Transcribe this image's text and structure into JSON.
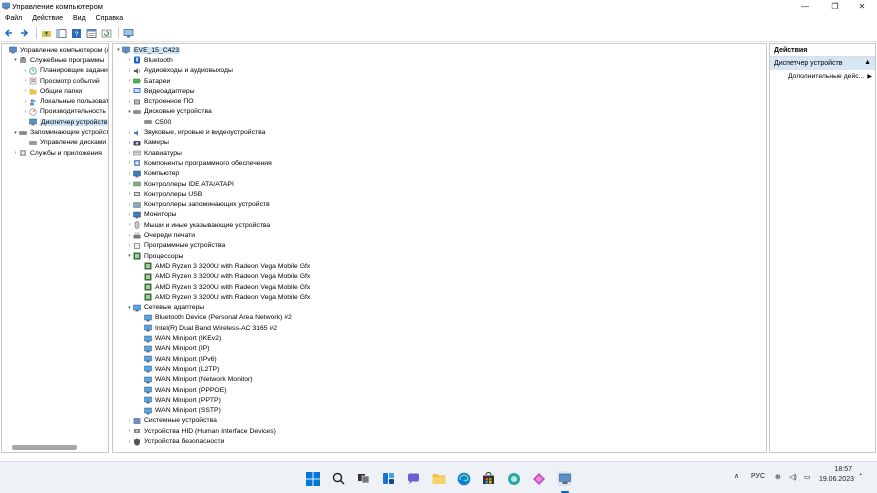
{
  "window": {
    "title": "Управление компьютером",
    "minimize": "—",
    "maximize": "❐",
    "close": "✕"
  },
  "menu": [
    "Файл",
    "Действие",
    "Вид",
    "Справка"
  ],
  "left_tree": [
    {
      "label": "Управление компьютером (лс",
      "level": 0,
      "arrow": "",
      "icon": "computer-management-icon"
    },
    {
      "label": "Служебные программы",
      "level": 1,
      "arrow": "▾",
      "icon": "tools-icon"
    },
    {
      "label": "Планировщик заданий",
      "level": 2,
      "arrow": "›",
      "icon": "clock-icon"
    },
    {
      "label": "Просмотр событий",
      "level": 2,
      "arrow": "›",
      "icon": "event-viewer-icon"
    },
    {
      "label": "Общие папки",
      "level": 2,
      "arrow": "›",
      "icon": "shared-folder-icon"
    },
    {
      "label": "Локальные пользовате",
      "level": 2,
      "arrow": "›",
      "icon": "users-icon"
    },
    {
      "label": "Производительность",
      "level": 2,
      "arrow": "›",
      "icon": "performance-icon"
    },
    {
      "label": "Диспетчер устройств",
      "level": 2,
      "arrow": "",
      "icon": "device-manager-icon",
      "selected": true
    },
    {
      "label": "Запоминающие устройств",
      "level": 1,
      "arrow": "▾",
      "icon": "storage-icon"
    },
    {
      "label": "Управление дисками",
      "level": 2,
      "arrow": "",
      "icon": "disk-icon"
    },
    {
      "label": "Службы и приложения",
      "level": 1,
      "arrow": "›",
      "icon": "services-icon"
    }
  ],
  "device_tree": [
    {
      "label": "EVE_15_C423",
      "level": 0,
      "arrow": "▾",
      "icon": "computer-icon",
      "selected": true
    },
    {
      "label": "Bluetooth",
      "level": 1,
      "arrow": "›",
      "icon": "bluetooth-icon"
    },
    {
      "label": "Аудиовходы и аудиовыходы",
      "level": 1,
      "arrow": "›",
      "icon": "audio-icon"
    },
    {
      "label": "Батареи",
      "level": 1,
      "arrow": "›",
      "icon": "battery-icon"
    },
    {
      "label": "Видеоадаптеры",
      "level": 1,
      "arrow": "›",
      "icon": "display-adapter-icon"
    },
    {
      "label": "Встроенное ПО",
      "level": 1,
      "arrow": "›",
      "icon": "firmware-icon"
    },
    {
      "label": "Дисковые устройства",
      "level": 1,
      "arrow": "▾",
      "icon": "disk-drive-icon"
    },
    {
      "label": "C500",
      "level": 2,
      "arrow": "",
      "icon": "disk-drive-icon"
    },
    {
      "label": "Звуковые, игровые и видеоустройства",
      "level": 1,
      "arrow": "›",
      "icon": "sound-icon"
    },
    {
      "label": "Камеры",
      "level": 1,
      "arrow": "›",
      "icon": "camera-icon"
    },
    {
      "label": "Клавиатуры",
      "level": 1,
      "arrow": "›",
      "icon": "keyboard-icon"
    },
    {
      "label": "Компоненты программного обеспечения",
      "level": 1,
      "arrow": "›",
      "icon": "software-icon"
    },
    {
      "label": "Компьютер",
      "level": 1,
      "arrow": "›",
      "icon": "monitor-icon"
    },
    {
      "label": "Контроллеры IDE ATA/ATAPI",
      "level": 1,
      "arrow": "›",
      "icon": "ide-icon"
    },
    {
      "label": "Контроллеры USB",
      "level": 1,
      "arrow": "›",
      "icon": "usb-icon"
    },
    {
      "label": "Контроллеры запоминающих устройств",
      "level": 1,
      "arrow": "›",
      "icon": "storage-controller-icon"
    },
    {
      "label": "Мониторы",
      "level": 1,
      "arrow": "›",
      "icon": "monitor-icon"
    },
    {
      "label": "Мыши и иные указывающие устройства",
      "level": 1,
      "arrow": "›",
      "icon": "mouse-icon"
    },
    {
      "label": "Очереди печати",
      "level": 1,
      "arrow": "›",
      "icon": "printer-icon"
    },
    {
      "label": "Программные устройства",
      "level": 1,
      "arrow": "›",
      "icon": "software-device-icon"
    },
    {
      "label": "Процессоры",
      "level": 1,
      "arrow": "▾",
      "icon": "processor-icon"
    },
    {
      "label": "AMD Ryzen 3 3200U with Radeon Vega Mobile Gfx",
      "level": 2,
      "arrow": "",
      "icon": "processor-icon"
    },
    {
      "label": "AMD Ryzen 3 3200U with Radeon Vega Mobile Gfx",
      "level": 2,
      "arrow": "",
      "icon": "processor-icon"
    },
    {
      "label": "AMD Ryzen 3 3200U with Radeon Vega Mobile Gfx",
      "level": 2,
      "arrow": "",
      "icon": "processor-icon"
    },
    {
      "label": "AMD Ryzen 3 3200U with Radeon Vega Mobile Gfx",
      "level": 2,
      "arrow": "",
      "icon": "processor-icon"
    },
    {
      "label": "Сетевые адаптеры",
      "level": 1,
      "arrow": "▾",
      "icon": "network-adapter-icon"
    },
    {
      "label": "Bluetooth Device (Personal Area Network) #2",
      "level": 2,
      "arrow": "",
      "icon": "network-adapter-icon"
    },
    {
      "label": "Intel(R) Dual Band Wireless-AC 3165 #2",
      "level": 2,
      "arrow": "",
      "icon": "network-adapter-icon"
    },
    {
      "label": "WAN Miniport (IKEv2)",
      "level": 2,
      "arrow": "",
      "icon": "network-adapter-icon"
    },
    {
      "label": "WAN Miniport (IP)",
      "level": 2,
      "arrow": "",
      "icon": "network-adapter-icon"
    },
    {
      "label": "WAN Miniport (IPv6)",
      "level": 2,
      "arrow": "",
      "icon": "network-adapter-icon"
    },
    {
      "label": "WAN Miniport (L2TP)",
      "level": 2,
      "arrow": "",
      "icon": "network-adapter-icon"
    },
    {
      "label": "WAN Miniport (Network Monitor)",
      "level": 2,
      "arrow": "",
      "icon": "network-adapter-icon"
    },
    {
      "label": "WAN Miniport (PPPOE)",
      "level": 2,
      "arrow": "",
      "icon": "network-adapter-icon"
    },
    {
      "label": "WAN Miniport (PPTP)",
      "level": 2,
      "arrow": "",
      "icon": "network-adapter-icon"
    },
    {
      "label": "WAN Miniport (SSTP)",
      "level": 2,
      "arrow": "",
      "icon": "network-adapter-icon"
    },
    {
      "label": "Системные устройства",
      "level": 1,
      "arrow": "›",
      "icon": "system-devices-icon"
    },
    {
      "label": "Устройства HID (Human Interface Devices)",
      "level": 1,
      "arrow": "›",
      "icon": "hid-icon"
    },
    {
      "label": "Устройства безопасности",
      "level": 1,
      "arrow": "›",
      "icon": "security-device-icon"
    }
  ],
  "actions": {
    "header": "Действия",
    "section": "Диспетчер устройств",
    "item": "Дополнительные дейс..."
  },
  "taskbar": {
    "lang": "РУС",
    "time": "18:57",
    "date": "19.06.2023",
    "icons": [
      "windows-start-icon",
      "search-icon",
      "task-view-icon",
      "widgets-icon",
      "chat-icon",
      "file-explorer-icon",
      "edge-icon",
      "store-icon",
      "app-icon",
      "app2-icon",
      "computer-management-taskbar-icon"
    ]
  },
  "colors": {
    "selection": "#cce4f7",
    "actions_section": "#d7e6f5",
    "accent": "#0067c0"
  }
}
